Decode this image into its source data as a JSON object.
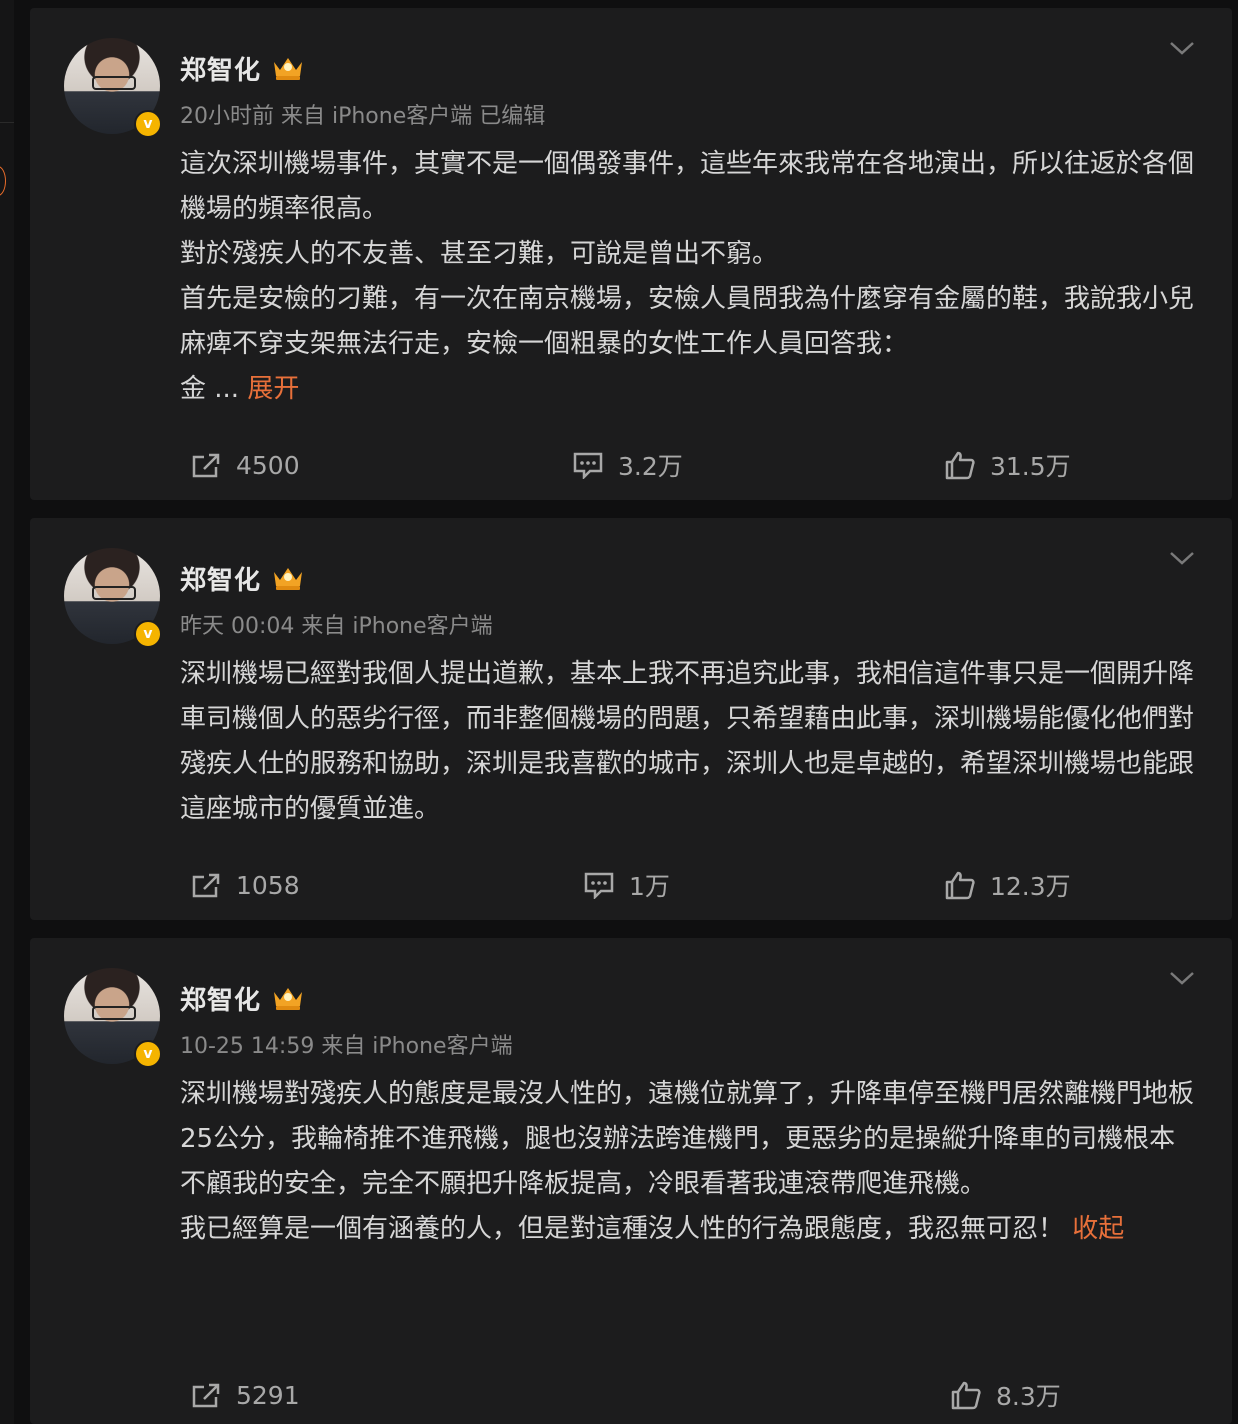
{
  "posts": [
    {
      "author": "郑智化",
      "meta": "20小时前  来自 iPhone客户端 已编辑",
      "paragraphs": [
        "這次深圳機場事件，其實不是一個偶發事件，這些年來我常在各地演出，所以往返於各個機場的頻率很高。",
        "對於殘疾人的不友善、甚至刁難，可說是曾出不窮。",
        "首先是安檢的刁難，有一次在南京機場，安檢人員問我為什麼穿有金屬的鞋，我說我小兒麻痺不穿支架無法行走，安檢一個粗暴的女性工作人員回答我："
      ],
      "tail_text": "金  ...",
      "expand_label": "展开",
      "reposts": "4500",
      "comments": "3.2万",
      "likes": "31.5万"
    },
    {
      "author": "郑智化",
      "meta": "昨天 00:04  来自 iPhone客户端",
      "paragraphs": [
        "深圳機場已經對我個人提出道歉，基本上我不再追究此事，我相信這件事只是一個開升降車司機個人的惡劣行徑，而非整個機場的問題，只希望藉由此事，深圳機場能優化他們對殘疾人仕的服務和協助，深圳是我喜歡的城市，深圳人也是卓越的，希望深圳機場也能跟這座城市的優質並進。"
      ],
      "reposts": "1058",
      "comments": "1万",
      "likes": "12.3万"
    },
    {
      "author": "郑智化",
      "meta": "10-25 14:59  来自 iPhone客户端",
      "paragraphs": [
        "深圳機場對殘疾人的態度是最沒人性的，遠機位就算了，升降車停至機門居然離機門地板25公分，我輪椅推不進飛機，腿也沒辦法跨進機門，更惡劣的是操縱升降車的司機根本不顧我的安全，完全不願把升降板提高，冷眼看著我連滾帶爬進飛機。"
      ],
      "last_paragraph": "我已經算是一個有涵養的人，但是對這種沒人性的行為跟態度，我忍無可忍！",
      "collapse_label": "收起",
      "reposts": "5291",
      "likes": "8.3万"
    }
  ],
  "icons": {
    "verified": "verified-badge-icon",
    "crown": "crown-icon",
    "more": "chevron-down-icon",
    "repost": "share-icon",
    "comment": "comment-icon",
    "like": "thumbs-up-icon"
  },
  "colors": {
    "background": "#0f0f10",
    "card": "#1c1c1d",
    "text": "#d6d6d6",
    "link": "#e8703a",
    "muted": "#8a8a8a"
  }
}
